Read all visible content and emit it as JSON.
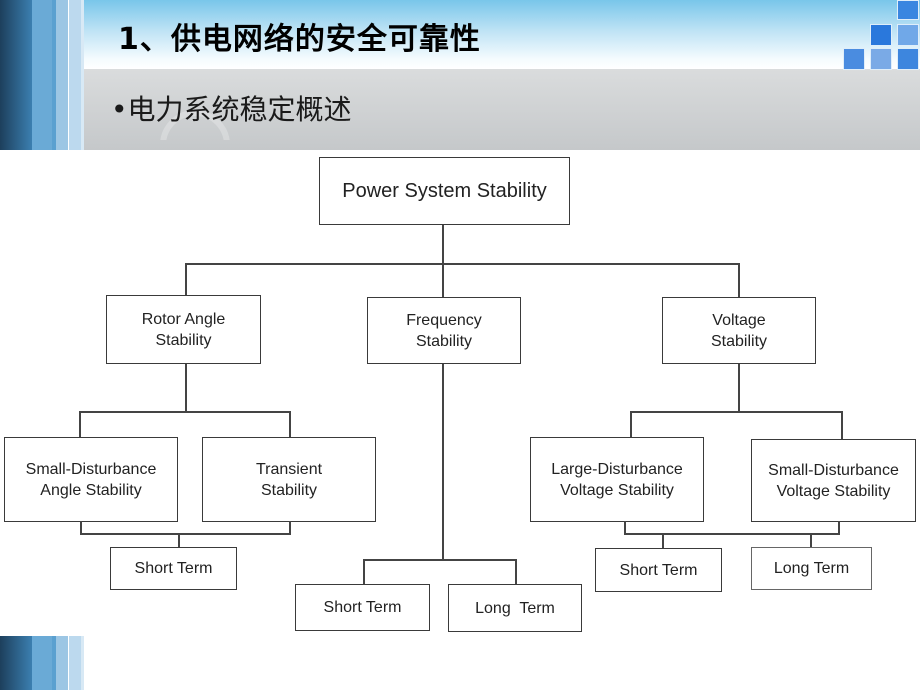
{
  "slide": {
    "title": "1、供电网络的安全可靠性",
    "subtitle": "•电力系统稳定概述"
  },
  "diagram": {
    "root": "Power System Stability",
    "categories": {
      "rotor_angle": {
        "label": "Rotor Angle Stability",
        "children": [
          "Small-Disturbance Angle Stability",
          "Transient Stability"
        ],
        "term": "Short Term"
      },
      "frequency": {
        "label": "Frequency Stability",
        "terms": [
          "Short Term",
          "Long  Term"
        ]
      },
      "voltage": {
        "label": "Voltage Stability",
        "children": [
          "Large-Disturbance Voltage Stability",
          "Small-Disturbance Voltage Stability"
        ],
        "terms": [
          "Short Term",
          "Long Term"
        ]
      }
    }
  },
  "decor": {
    "corner_square_colors": [
      "#3a86e0",
      "#2a78dc",
      "#70a8e8",
      "#4a8ce0",
      "#7aaae6",
      "#3d86de"
    ]
  }
}
